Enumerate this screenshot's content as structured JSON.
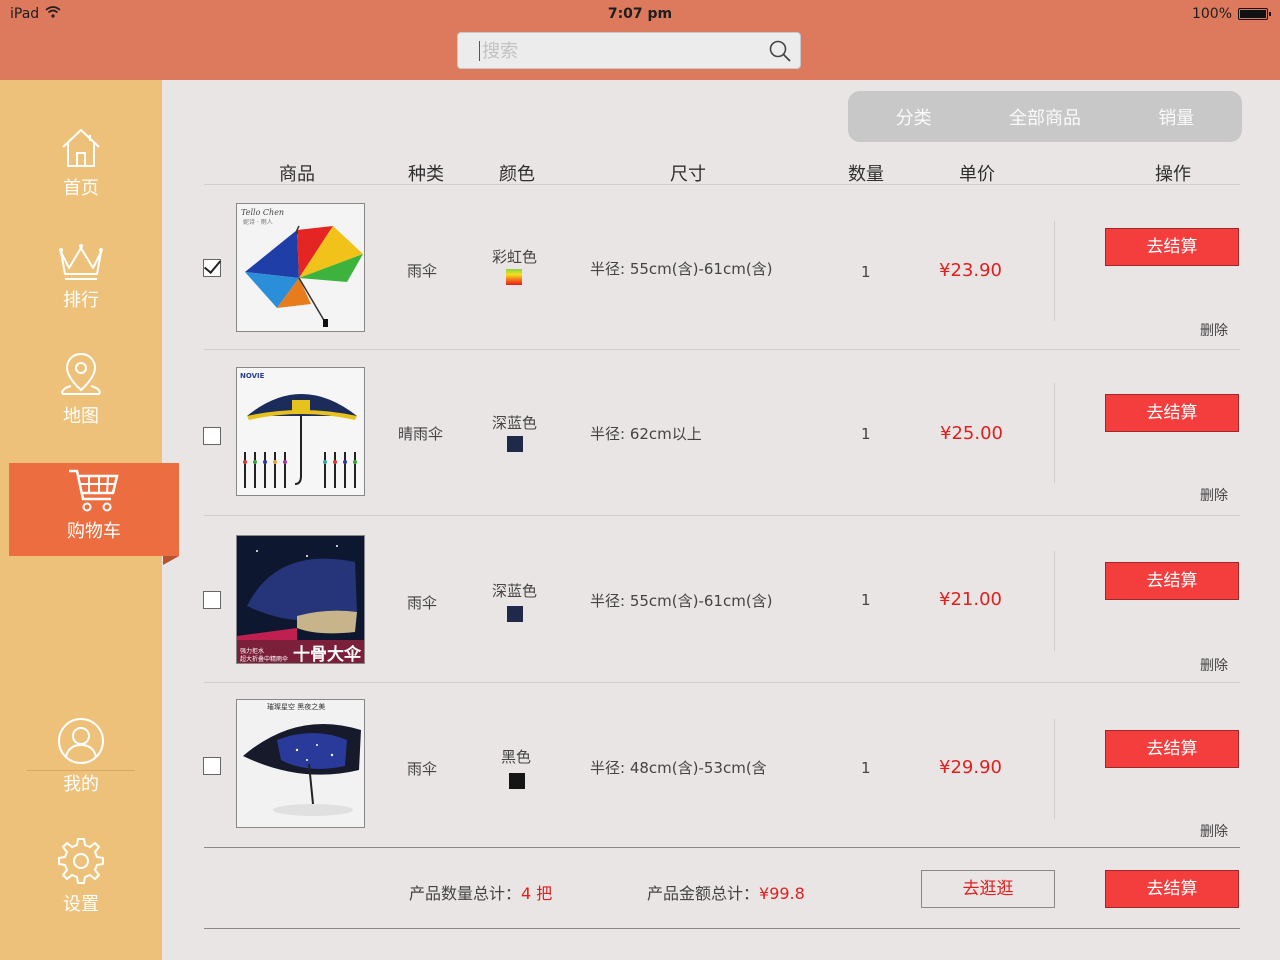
{
  "status_bar": {
    "device": "iPad",
    "time": "7:07 pm",
    "battery": "100%"
  },
  "search": {
    "placeholder": "搜索"
  },
  "sidebar": {
    "items": [
      {
        "label": "首页",
        "icon": "home-icon"
      },
      {
        "label": "排行",
        "icon": "crown-icon"
      },
      {
        "label": "地图",
        "icon": "map-pin-icon"
      },
      {
        "label": "购物车",
        "icon": "cart-icon",
        "active": true
      },
      {
        "label": "我的",
        "icon": "user-icon"
      },
      {
        "label": "设置",
        "icon": "gear-icon"
      }
    ]
  },
  "sort_tabs": [
    "分类",
    "全部商品",
    "销量"
  ],
  "table": {
    "headers": [
      "商品",
      "种类",
      "颜色",
      "尺寸",
      "数量",
      "单价",
      "操作"
    ],
    "rows": [
      {
        "checked": true,
        "type": "雨伞",
        "color_name": "彩虹色",
        "size": "半径: 55cm(含)-61cm(含)",
        "quantity": "1",
        "price": "¥23.90",
        "action": "去结算",
        "delete": "删除"
      },
      {
        "checked": false,
        "type": "晴雨伞",
        "color_name": "深蓝色",
        "size": "半径: 62cm以上",
        "quantity": "1",
        "price": "¥25.00",
        "action": "去结算",
        "delete": "删除"
      },
      {
        "checked": false,
        "type": "雨伞",
        "color_name": "深蓝色",
        "size": "半径: 55cm(含)-61cm(含)",
        "quantity": "1",
        "price": "¥21.00",
        "action": "去结算",
        "delete": "删除"
      },
      {
        "checked": false,
        "type": "雨伞",
        "color_name": "黑色",
        "size": "半径: 48cm(含)-53cm(含",
        "quantity": "1",
        "price": "¥29.90",
        "action": "去结算",
        "delete": "删除"
      }
    ]
  },
  "product_images": {
    "row1": {
      "brand": "Tello Chen",
      "sub": "妮诗 · 雨人"
    },
    "row2": {
      "brand": "NOVIE"
    },
    "row3": {
      "caption_small_1": "强力拒水",
      "caption_small_2": "超大折叠中精雨伞",
      "caption_big": "十骨大伞"
    },
    "row4": {
      "caption": "璀璨星空 黑夜之美"
    }
  },
  "footer": {
    "qty_label": "产品数量总计：",
    "qty_value": "4 把",
    "amount_label": "产品金额总计：",
    "amount_value": "¥99.8",
    "browse_button": "去逛逛",
    "pay_button": "去结算"
  },
  "colors": {
    "topbar": "#dd7a5e",
    "sidebar": "#eec17a",
    "active_nav": "#ec6d40",
    "button_red": "#f43d3d",
    "price_red": "#e02020",
    "swatch_navy": "#1f2a4a",
    "swatch_black": "#151515"
  }
}
